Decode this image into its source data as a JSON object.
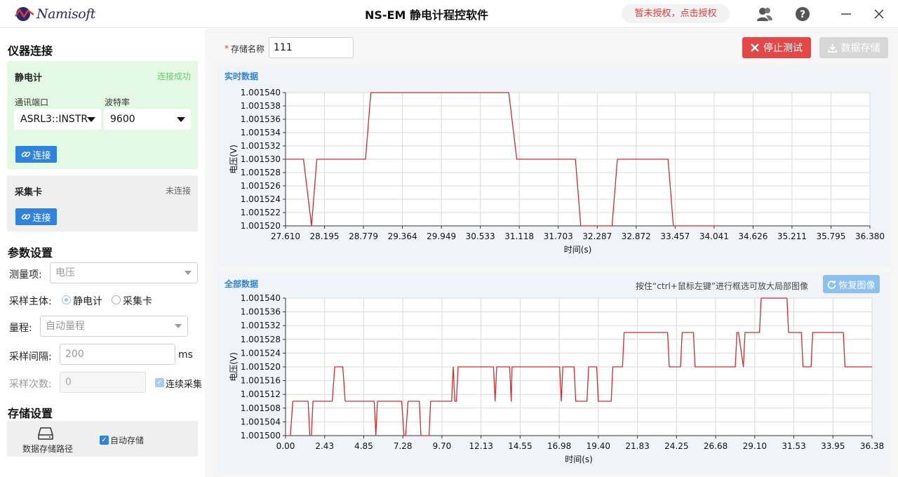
{
  "titlebar": {
    "logo_text": "Namisoft",
    "title": "NS-EM 静电计程控软件",
    "license_text": "暂未授权，点击授权",
    "icons": [
      "users-icon",
      "help-icon",
      "minimize-icon",
      "close-icon"
    ]
  },
  "sidebar": {
    "instrument_section_title": "仪器连接",
    "electrometer": {
      "title": "静电计",
      "status": "连接成功",
      "port_label": "通讯端口",
      "port_value": "ASRL3::INSTR",
      "baud_label": "波特率",
      "baud_value": "9600",
      "connect_label": "连接"
    },
    "daq": {
      "title": "采集卡",
      "status": "未连接",
      "connect_label": "连接"
    },
    "params_section_title": "参数设置",
    "measure_label": "测量项:",
    "measure_value": "电压",
    "subject_label": "采样主体:",
    "subject_option1": "静电计",
    "subject_option2": "采集卡",
    "range_label": "量程:",
    "range_value": "自动量程",
    "interval_label": "采样间隔:",
    "interval_value": "200",
    "interval_unit": "ms",
    "count_label": "采样次数:",
    "count_value": "0",
    "continuous_label": "连续采集",
    "storage_section_title": "存储设置",
    "storage_path_label": "数据存储路径",
    "auto_save_label": "自动存储"
  },
  "toolbar": {
    "required_mark": "*",
    "name_label": "存储名称",
    "name_value": "111",
    "stop_label": "停止测试",
    "save_label": "数据存储"
  },
  "realtime_panel": {
    "title": "实时数据"
  },
  "all_panel": {
    "title": "全部数据",
    "hint": "按住“ctrl+鼠标左键”进行框选可放大局部图像",
    "restore_label": "恢复图像"
  },
  "colors": {
    "line": "#d42a2a",
    "accent_blue": "#2f83dd",
    "stop_red": "#e44747",
    "connected_green": "#66cc66",
    "card_green_bg": "#e4f9e4",
    "card_gray_bg": "#efefef"
  },
  "chart_data": [
    {
      "type": "line",
      "title": "实时数据",
      "xlabel": "时间(s)",
      "ylabel": "电压(V)",
      "xlim": [
        27.61,
        36.38
      ],
      "ylim": [
        1.00152,
        1.00154
      ],
      "grid": true,
      "x_ticks": [
        "27.610",
        "28.195",
        "28.779",
        "29.364",
        "29.949",
        "30.533",
        "31.118",
        "31.703",
        "32.287",
        "32.872",
        "33.457",
        "34.041",
        "34.626",
        "35.211",
        "35.795",
        "36.380"
      ],
      "y_ticks": [
        "1.001520",
        "1.001522",
        "1.001524",
        "1.001526",
        "1.001528",
        "1.001530",
        "1.001532",
        "1.001534",
        "1.001536",
        "1.001538",
        "1.001540"
      ],
      "series": [
        {
          "x": [
            27.61,
            27.88,
            28.0,
            28.08,
            28.81,
            28.89,
            30.96,
            31.08,
            31.96,
            32.04,
            32.51,
            32.59,
            33.35,
            33.43,
            34.1
          ],
          "y": [
            1.00153,
            1.00153,
            1.00152,
            1.00153,
            1.00153,
            1.00154,
            1.00154,
            1.00153,
            1.00153,
            1.00152,
            1.00152,
            1.00153,
            1.00153,
            1.00152,
            1.00152
          ]
        }
      ]
    },
    {
      "type": "line",
      "title": "全部数据",
      "xlabel": "时间(s)",
      "ylabel": "电压(V)",
      "xlim": [
        0,
        36.38
      ],
      "ylim": [
        1.0015,
        1.00154
      ],
      "grid": true,
      "x_ticks": [
        "0.00",
        "2.43",
        "4.85",
        "7.28",
        "9.70",
        "12.13",
        "14.55",
        "16.98",
        "19.40",
        "21.83",
        "24.25",
        "26.68",
        "29.10",
        "31.53",
        "33.95",
        "36.38"
      ],
      "y_ticks": [
        "1.001500",
        "1.001504",
        "1.001508",
        "1.001512",
        "1.001516",
        "1.001520",
        "1.001524",
        "1.001528",
        "1.001532",
        "1.001536",
        "1.001540"
      ],
      "series": [
        {
          "x": [
            0,
            0.3,
            0.45,
            1.4,
            1.5,
            1.6,
            1.7,
            2.9,
            3.05,
            3.55,
            3.7,
            5.5,
            5.6,
            5.7,
            7.2,
            7.35,
            7.45,
            7.6,
            8.3,
            8.4,
            8.9,
            9.0,
            9.2,
            10.3,
            10.4,
            10.5,
            10.6,
            10.7,
            10.8,
            12.9,
            13.0,
            13.1,
            13.2,
            13.9,
            14.0,
            14.05,
            14.15,
            17.0,
            17.1,
            17.2,
            17.9,
            18.0,
            18.7,
            18.8,
            19.3,
            19.4,
            20.2,
            20.3,
            20.9,
            21.0,
            23.7,
            23.8,
            24.5,
            24.6,
            25.3,
            25.4,
            26.2,
            27.9,
            28.0,
            28.1,
            28.4,
            28.5,
            29.4,
            29.5,
            31.1,
            31.2,
            32.0,
            32.1,
            32.6,
            32.7,
            33.5,
            33.6,
            34.6,
            34.7,
            36.38
          ],
          "y": [
            1.0015,
            1.0015,
            1.00151,
            1.00151,
            1.0015,
            1.0015,
            1.00151,
            1.00151,
            1.00152,
            1.00152,
            1.00151,
            1.00151,
            1.0015,
            1.00151,
            1.00151,
            1.0015,
            1.0015,
            1.00151,
            1.00151,
            1.0015,
            1.0015,
            1.00151,
            1.00151,
            1.00151,
            1.00152,
            1.00151,
            1.00151,
            1.00152,
            1.00152,
            1.00152,
            1.00151,
            1.00152,
            1.00152,
            1.00152,
            1.00151,
            1.00152,
            1.00152,
            1.00152,
            1.00151,
            1.00152,
            1.00152,
            1.00151,
            1.00151,
            1.00152,
            1.00152,
            1.00151,
            1.00151,
            1.00152,
            1.00152,
            1.00153,
            1.00153,
            1.00152,
            1.00152,
            1.00153,
            1.00153,
            1.00152,
            1.00152,
            1.00152,
            1.00153,
            1.00153,
            1.00152,
            1.00153,
            1.00153,
            1.00154,
            1.00154,
            1.00153,
            1.00153,
            1.00152,
            1.00152,
            1.00153,
            1.00153,
            1.00153,
            1.00153,
            1.00152,
            1.00152
          ]
        }
      ]
    }
  ]
}
